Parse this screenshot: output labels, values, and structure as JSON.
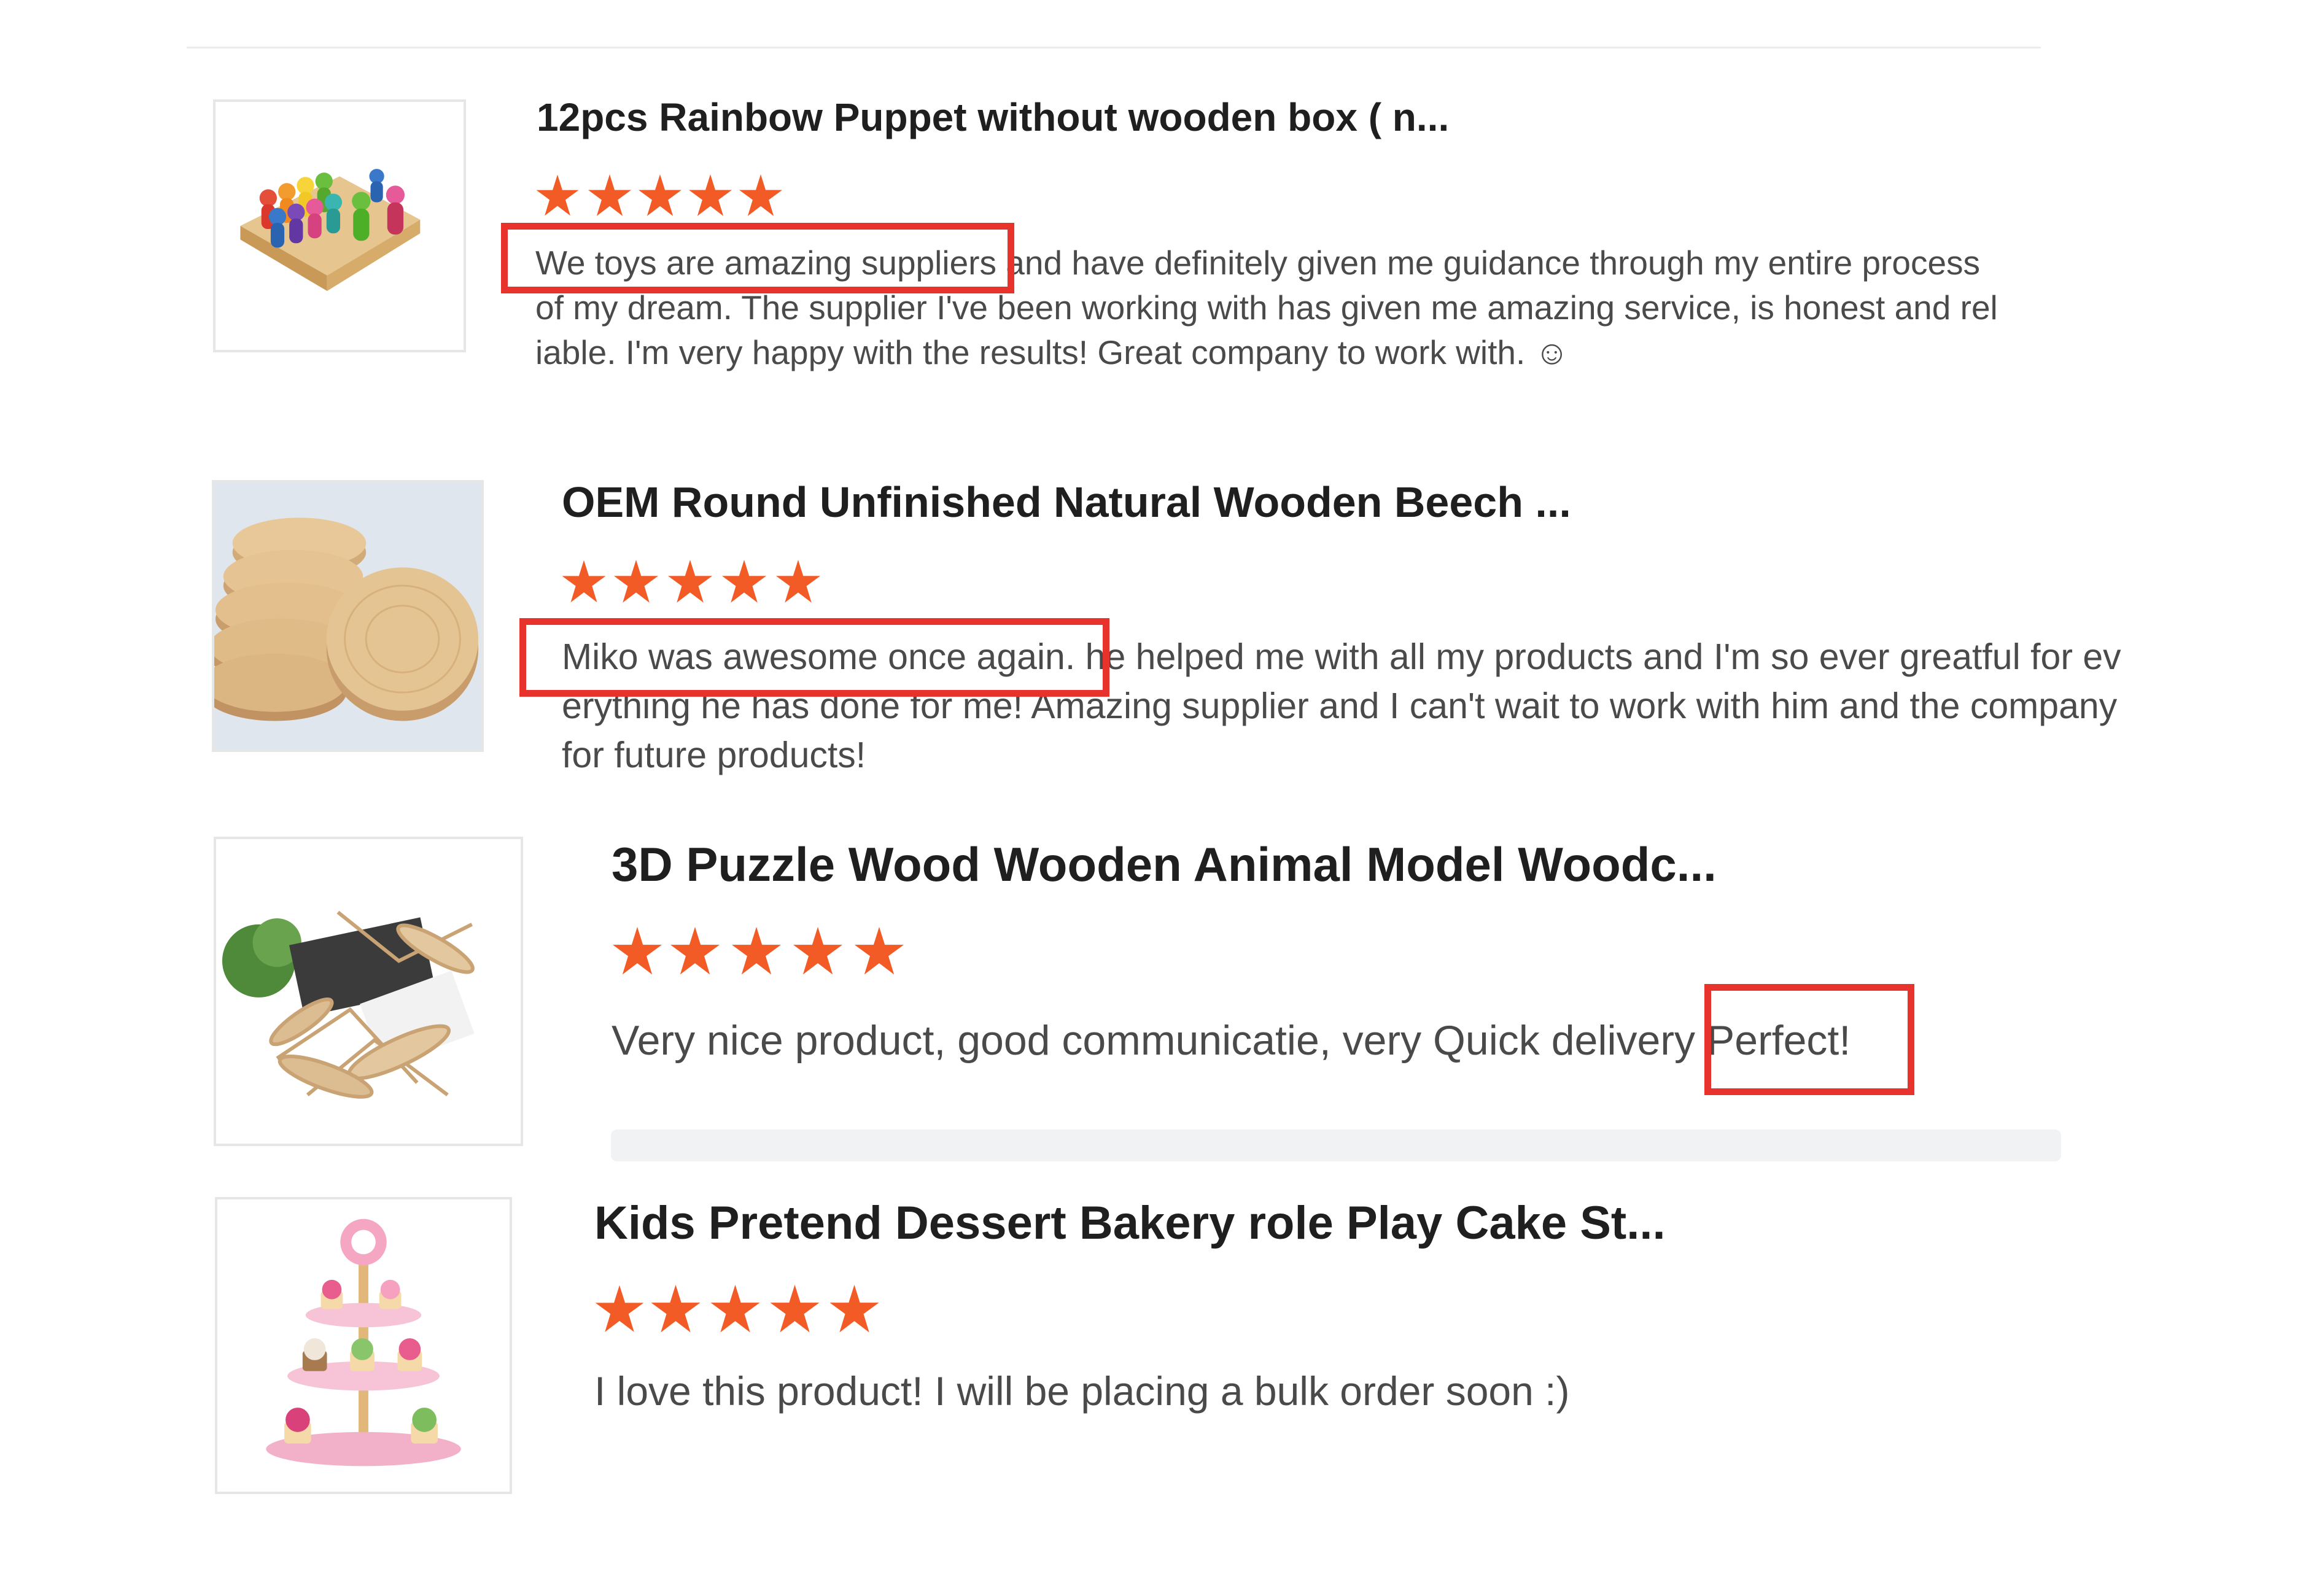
{
  "colors": {
    "star": "#f25a26",
    "highlight": "#e8332c",
    "title": "#1f1f1f",
    "body_text": "#4a4a4a",
    "divider": "#ececec"
  },
  "reviews": [
    {
      "title": "12pcs Rainbow Puppet without wooden box ( n...",
      "rating": 5,
      "text_lines": [
        "We toys are amazing suppliers and have definitely given me guidance through my entire process",
        "of my dream. The supplier I've been working with has given me amazing service, is honest and rel",
        "iable.  I'm very happy with the results!  Great company to work with. ☺"
      ],
      "highlight": "We toys are amazing suppliers",
      "image": "rainbow-peg-dolls-image"
    },
    {
      "title": "OEM Round Unfinished Natural Wooden Beech ...",
      "rating": 5,
      "text_lines": [
        "Miko was awesome once again. he helped me with all my products and I'm so ever greatful for ev",
        "erything he has done for me! Amazing supplier and I can't wait to work with him and the company",
        "for future products!"
      ],
      "highlight": "Miko was awesome once again.",
      "image": "wooden-discs-image"
    },
    {
      "title": "3D Puzzle Wood Wooden Animal Model Woodc...",
      "rating": 5,
      "text_lines": [
        "Very nice product, good communicatie, very Quick delivery Perfect!"
      ],
      "highlight": "Perfect!",
      "image": "wooden-insect-puzzle-image"
    },
    {
      "title": "Kids Pretend Dessert Bakery role Play Cake St...",
      "rating": 5,
      "text_lines": [
        "I love this product! I will be placing a bulk order soon :)"
      ],
      "highlight": "",
      "image": "cake-stand-toy-image"
    }
  ]
}
